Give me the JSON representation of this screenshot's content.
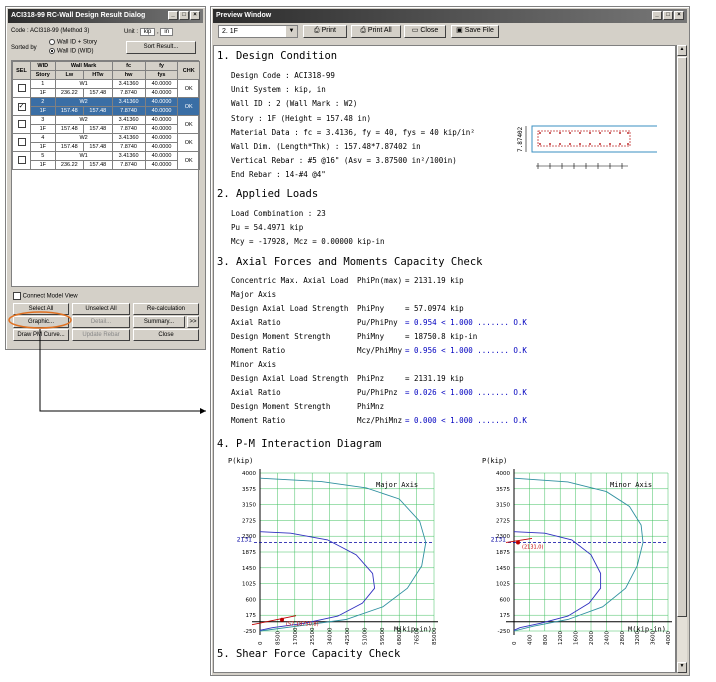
{
  "dialog": {
    "title": "ACI318-99 RC-Wall Design Result Dialog",
    "code_text": "Code : ACI318-99 (Method 3)",
    "unit_label": "Unit :",
    "unit_force": "kip",
    "unit_sep": ",",
    "unit_length": "in",
    "sorted_by": "Sorted by",
    "sort_option1": "Wall ID + Story",
    "sort_option2": "Wall ID (WID)",
    "sort_button": "Sort Result...",
    "headers": {
      "sel": "SEL",
      "wid": "WID",
      "story": "Story",
      "wallmark": "Wall Mark",
      "lw": "Lw",
      "htw": "HTw",
      "fc": "fc",
      "hw": "hw",
      "fy": "fy",
      "fys": "fys",
      "chk": "CHK"
    },
    "rows": [
      {
        "wid": "1",
        "mark": "W1",
        "fc": "3.41360",
        "fy": "40.0000",
        "chk": "OK",
        "story": "1F",
        "lw": "236.22",
        "htw": "157.48",
        "hw": "7.8740",
        "fys": "40.0000",
        "checked": false
      },
      {
        "wid": "2",
        "mark": "W2",
        "fc": "3.41360",
        "fy": "40.0000",
        "chk": "OK",
        "story": "1F",
        "lw": "157.48",
        "htw": "157.48",
        "hw": "7.8740",
        "fys": "40.0000",
        "checked": true
      },
      {
        "wid": "3",
        "mark": "W2",
        "fc": "3.41360",
        "fy": "40.0000",
        "chk": "OK",
        "story": "1F",
        "lw": "157.48",
        "htw": "157.48",
        "hw": "7.8740",
        "fys": "40.0000",
        "checked": false
      },
      {
        "wid": "4",
        "mark": "W2",
        "fc": "3.41360",
        "fy": "40.0000",
        "chk": "OK",
        "story": "1F",
        "lw": "157.48",
        "htw": "157.48",
        "hw": "7.8740",
        "fys": "40.0000",
        "checked": false
      },
      {
        "wid": "5",
        "mark": "W1",
        "fc": "3.41360",
        "fy": "40.0000",
        "chk": "OK",
        "story": "1F",
        "lw": "236.22",
        "htw": "157.48",
        "hw": "7.8740",
        "fys": "40.0000",
        "checked": false
      }
    ],
    "connect_model": "Connect Model View",
    "select_all": "Select All",
    "unselect_all": "Unselect All",
    "recalc": "Re-calculation",
    "graphic": "Graphic...",
    "detail": "Detail...",
    "summary": "Summary...",
    "more": ">>",
    "draw_pm": "Draw PM Curve...",
    "update_rebar": "Update Rebar",
    "close": "Close"
  },
  "preview": {
    "title": "Preview Window",
    "page_select": "2.   1F",
    "print": "Print",
    "print_all": "Print All",
    "close": "Close",
    "save_file": "Save File",
    "s1_title": "1. Design Condition",
    "s1_lines": [
      "Design Code      :  ACI318-99",
      "Unit System      :  kip, in",
      "Wall ID          :  2  (Wall Mark : W2)",
      "Story            :  1F  (Height = 157.48 in)",
      "Material Data    :  fc = 3.4136,   fy = 40,   fys = 40 kip/in²",
      "Wall Dim.  (Length*Thk) :  157.48*7.87402 in",
      "Vertical Rebar   :  #5 @16\"  (Asv = 3.87500 in²/100in)",
      "End Rebar        :  14-#4  @4\""
    ],
    "sketch_dim": "7.87402",
    "s2_title": "2. Applied Loads",
    "s2_lines": [
      "Load Combination  :   23",
      "Pu      = 54.4971 kip",
      "Mcy     =  -17928,          Mcz    = 0.00000 kip-in"
    ],
    "s3_title": "3. Axial Forces and Moments Capacity Check",
    "s3_rows": [
      {
        "l": "Concentric Max. Axial Load",
        "m": "PhiPn(max)",
        "r": "= 2131.19  kip",
        "b": false
      },
      {
        "l": "Major Axis",
        "m": "",
        "r": "",
        "b": false
      },
      {
        "l": "  Design Axial Load Strength",
        "m": "PhiPny",
        "r": "= 57.0974  kip",
        "b": false
      },
      {
        "l": "  Axial Ratio",
        "m": "Pu/PhiPny",
        "r": "= 0.954  < 1.000 ....... O.K",
        "b": true
      },
      {
        "l": "  Design Moment Strength",
        "m": "PhiMny",
        "r": "= 18750.8  kip-in",
        "b": false
      },
      {
        "l": "  Moment Ratio",
        "m": "Mcy/PhiMny",
        "r": "= 0.956  < 1.000 ....... O.K",
        "b": true
      },
      {
        "l": "Minor Axis",
        "m": "",
        "r": "",
        "b": false
      },
      {
        "l": "  Design Axial Load Strength",
        "m": "PhiPnz",
        "r": "= 2131.19  kip",
        "b": false
      },
      {
        "l": "  Axial Ratio",
        "m": "Pu/PhiPnz",
        "r": "= 0.026  < 1.000 ....... O.K",
        "b": true
      },
      {
        "l": "  Design Moment Strength",
        "m": "PhiMnz",
        "r": "",
        "b": false
      },
      {
        "l": "  Moment Ratio",
        "m": "Mcz/PhiMnz",
        "r": "= 0.000  < 1.000 ....... O.K",
        "b": true
      }
    ],
    "s4_title": "4. P-M Interaction Diagram",
    "s5_title": "5. Shear Force Capacity Check"
  },
  "chart_data": [
    {
      "type": "line",
      "title": "Major Axis",
      "ylabel": "P(kip)",
      "xlabel": "M(kip-in)",
      "y_ticks": [
        "4000",
        "3575",
        "3150",
        "2725",
        "2300",
        "1875",
        "1450",
        "1025",
        "600",
        "175",
        "-250"
      ],
      "x_ticks": [
        "0",
        "8500",
        "17000",
        "25500",
        "34000",
        "42500",
        "51000",
        "59500",
        "68000",
        "76500",
        "85000"
      ],
      "ref_label": "2131",
      "point_label": "(57,18750.8)",
      "ylim": [
        -250,
        4000
      ],
      "xlim": [
        0,
        85000
      ],
      "series": [
        {
          "color": "#3090a0",
          "x": [
            0,
            30000,
            52000,
            68000,
            78000,
            81000,
            79000,
            72000,
            60000,
            42000,
            18000,
            0
          ],
          "y": [
            3860,
            3770,
            3600,
            3300,
            2700,
            2131,
            1500,
            900,
            400,
            60,
            -120,
            -250
          ]
        },
        {
          "color": "#3030c0",
          "x": [
            0,
            15000,
            33000,
            47000,
            55000,
            56000,
            50000,
            38000,
            22000,
            6000,
            0
          ],
          "y": [
            2420,
            2380,
            2200,
            1800,
            1300,
            900,
            500,
            150,
            -40,
            -160,
            -230
          ]
        }
      ]
    },
    {
      "type": "line",
      "title": "Minor Axis",
      "ylabel": "P(kip)",
      "xlabel": "M(kip-in)",
      "y_ticks": [
        "4000",
        "3575",
        "3150",
        "2725",
        "2300",
        "1875",
        "1450",
        "1025",
        "600",
        "175",
        "-250"
      ],
      "x_ticks": [
        "0",
        "400",
        "800",
        "1200",
        "1600",
        "2000",
        "2400",
        "2800",
        "3200",
        "3600",
        "4000"
      ],
      "ref_label": "2131",
      "point_label": "(2131,0)",
      "ylim": [
        -250,
        4000
      ],
      "xlim": [
        0,
        4000
      ],
      "series": [
        {
          "color": "#3090a0",
          "x": [
            0,
            1400,
            2400,
            3000,
            3300,
            3350,
            3200,
            2900,
            2300,
            1400,
            500,
            0
          ],
          "y": [
            3860,
            3760,
            3500,
            3100,
            2600,
            2131,
            1500,
            900,
            400,
            60,
            -120,
            -250
          ]
        },
        {
          "color": "#3030c0",
          "x": [
            0,
            800,
            1500,
            2000,
            2250,
            2250,
            1950,
            1400,
            700,
            150,
            0
          ],
          "y": [
            2420,
            2380,
            2200,
            1800,
            1300,
            900,
            500,
            150,
            -40,
            -160,
            -230
          ]
        }
      ]
    }
  ]
}
